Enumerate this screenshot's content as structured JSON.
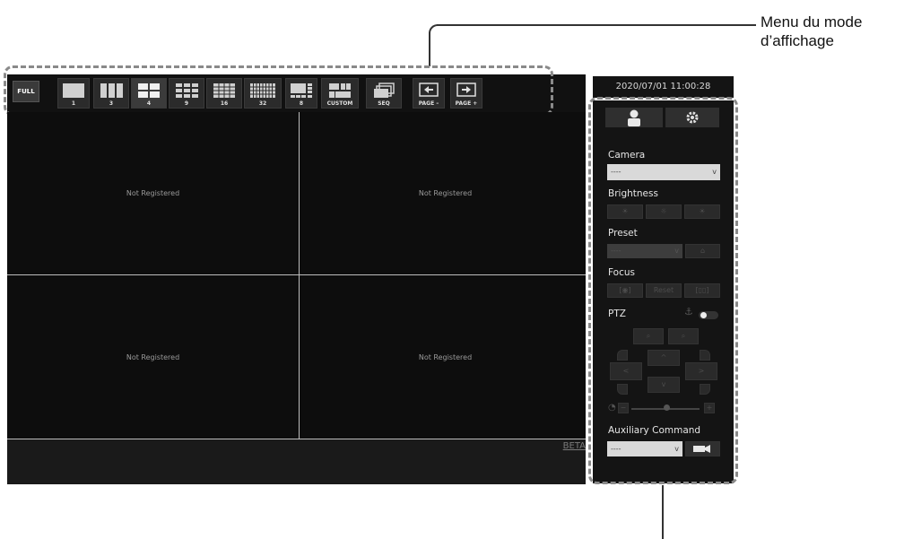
{
  "callout": {
    "line1": "Menu du mode",
    "line2": "d’affichage"
  },
  "toolbar": {
    "full_label": "FULL",
    "layouts": [
      {
        "label": "1",
        "icon": "layout-1-icon",
        "active": false
      },
      {
        "label": "3",
        "icon": "layout-3-icon",
        "active": false
      },
      {
        "label": "4",
        "icon": "layout-4-icon",
        "active": true
      },
      {
        "label": "9",
        "icon": "layout-9-icon",
        "active": false
      },
      {
        "label": "16",
        "icon": "layout-16-icon",
        "active": false
      },
      {
        "label": "32",
        "icon": "layout-32-icon",
        "active": false
      },
      {
        "label": "8",
        "icon": "layout-8-icon",
        "active": false
      },
      {
        "label": "CUSTOM",
        "icon": "layout-custom-icon",
        "active": false
      },
      {
        "label": "SEQ",
        "icon": "sequence-icon",
        "active": false
      },
      {
        "label": "PAGE –",
        "icon": "arrow-left-icon",
        "active": false
      },
      {
        "label": "PAGE +",
        "icon": "arrow-right-icon",
        "active": false
      }
    ]
  },
  "video": {
    "cells": [
      "Not Registered",
      "Not Registered",
      "Not Registered",
      "Not Registered"
    ],
    "beta_label": "BETA"
  },
  "panel": {
    "datetime": "2020/07/01 11:00:28",
    "tabs": [
      {
        "icon": "user-icon"
      },
      {
        "icon": "gear-icon"
      }
    ],
    "camera_label": "Camera",
    "camera_value": "----",
    "brightness_label": "Brightness",
    "preset_label": "Preset",
    "preset_value": "----",
    "focus_label": "Focus",
    "focus_reset": "Reset",
    "ptz_label": "PTZ",
    "aux_label": "Auxiliary Command",
    "aux_value": "----"
  },
  "colors": {
    "panel_bg": "#141414",
    "toolbar_bg": "#111111",
    "grid_line": "#bdbdbd"
  }
}
